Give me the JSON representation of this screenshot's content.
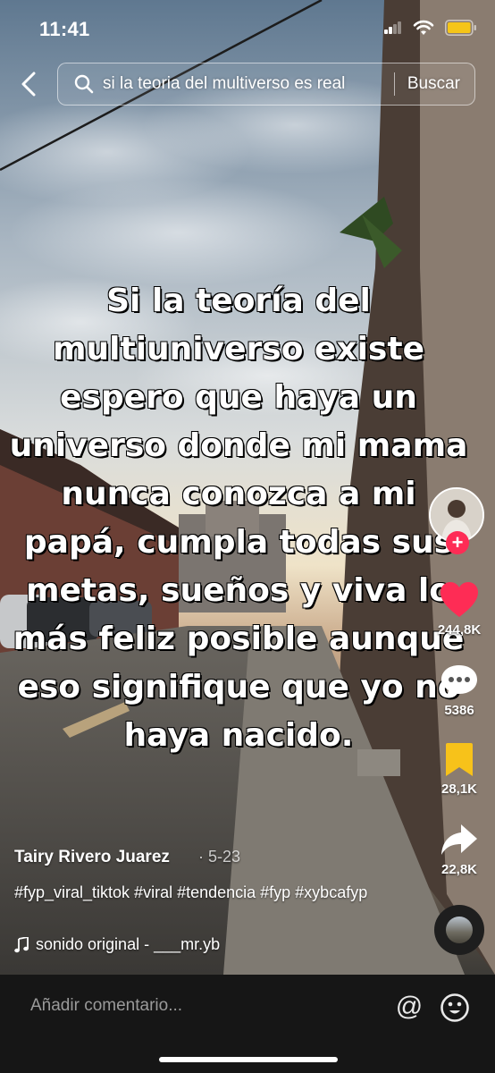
{
  "status_bar": {
    "time": "11:41",
    "icons": [
      "signal-icon",
      "wifi-icon",
      "battery-icon"
    ],
    "battery_color": "#f5c518"
  },
  "search": {
    "query": "si la teoria del multiverso es real",
    "button_label": "Buscar"
  },
  "video": {
    "caption": "Si la teoría del multiuniverso existe espero que haya un universo donde mi mama nunca conozca a mi papá, cumpla todas sus metas, sueños y viva lo más feliz posible aunque eso signifique que yo no haya nacido."
  },
  "actions": {
    "likes": "244,8K",
    "comments": "5386",
    "saves": "28,1K",
    "shares": "22,8K",
    "like_color": "#fe2c55",
    "save_color": "#f7c21a"
  },
  "post": {
    "author": "Tairy Rivero Juarez",
    "date": "5-23",
    "hashtags": "#fyp_viral_tiktok #viral #tendencia #fyp #xybcafyp",
    "sound": "sonido original - ___mr.yb"
  },
  "comment_bar": {
    "placeholder": "Añadir comentario...",
    "mention_symbol": "@"
  }
}
